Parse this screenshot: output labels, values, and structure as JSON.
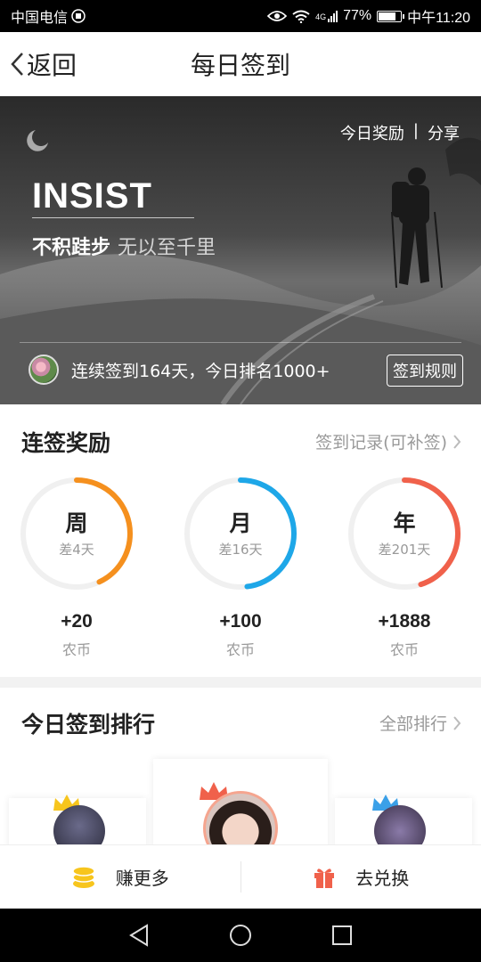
{
  "status_bar": {
    "carrier": "中国电信",
    "network": "4G",
    "battery_text": "77%",
    "battery_level": 0.77,
    "time": "中午11:20"
  },
  "header": {
    "back_label": "返回",
    "title": "每日签到"
  },
  "banner": {
    "today_reward_label": "今日奖励",
    "separator": "|",
    "share_label": "分享",
    "headline": "INSIST",
    "slogan_main": "不积跬步",
    "slogan_sub": "无以至千里",
    "streak_text": "连续签到164天，今日排名1000+",
    "rules_button": "签到规则"
  },
  "rewards": {
    "title": "连签奖励",
    "record_link": "签到记录(可补签)",
    "items": [
      {
        "period": "周",
        "remaining": "差4天",
        "amount": "+20",
        "unit": "农币",
        "color": "#f5901e",
        "progress": 0.43
      },
      {
        "period": "月",
        "remaining": "差16天",
        "amount": "+100",
        "unit": "农币",
        "color": "#1ea7e8",
        "progress": 0.48
      },
      {
        "period": "年",
        "remaining": "差201天",
        "amount": "+1888",
        "unit": "农币",
        "color": "#f0614b",
        "progress": 0.45
      }
    ]
  },
  "ranking": {
    "title": "今日签到排行",
    "all_link": "全部排行"
  },
  "bottom_bar": {
    "earn_label": "赚更多",
    "exchange_label": "去兑换"
  },
  "colors": {
    "coin": "#f7c51d",
    "gift": "#f0614b",
    "crown_gold": "#f7c51d",
    "crown_red": "#f0614b",
    "crown_blue": "#3aa0e8"
  }
}
